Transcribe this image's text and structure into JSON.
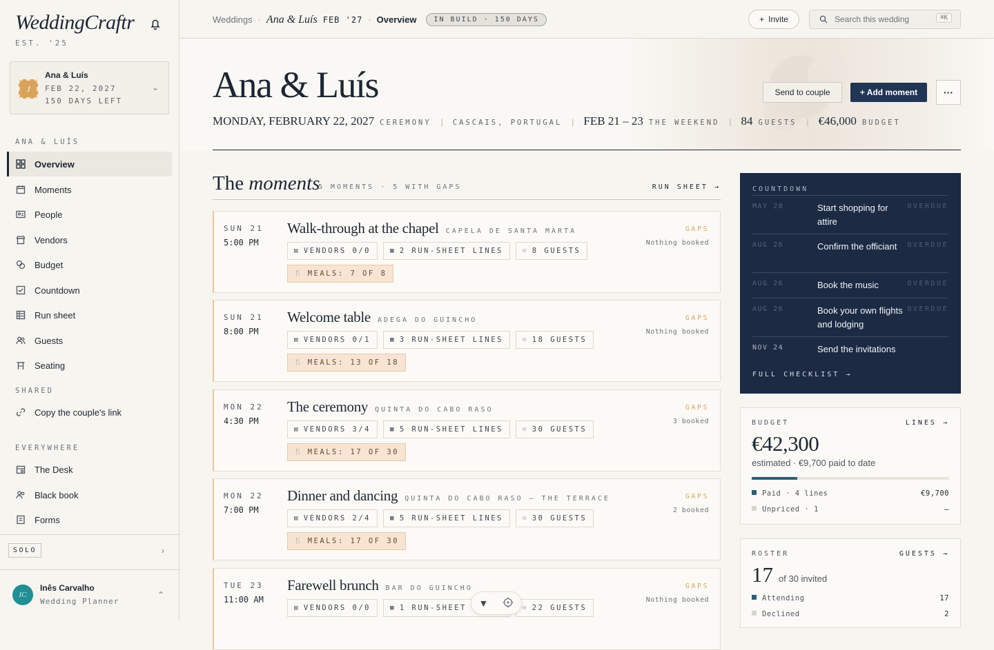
{
  "app": {
    "logo": "WeddingCraftr",
    "est": "EST. '25"
  },
  "wedding_card": {
    "stamp": "J",
    "names": "Ana & Luís",
    "date": "FEB 22, 2027",
    "left": "150 DAYS LEFT"
  },
  "sidebar": {
    "section_couple": "ANA & LUÍS",
    "items": [
      {
        "label": "Overview",
        "icon": "grid-icon"
      },
      {
        "label": "Moments",
        "icon": "calendar-icon"
      },
      {
        "label": "People",
        "icon": "id-card-icon"
      },
      {
        "label": "Vendors",
        "icon": "store-icon"
      },
      {
        "label": "Budget",
        "icon": "coins-icon"
      },
      {
        "label": "Countdown",
        "icon": "checklist-icon"
      },
      {
        "label": "Run sheet",
        "icon": "run-sheet-icon"
      },
      {
        "label": "Guests",
        "icon": "users-icon"
      },
      {
        "label": "Seating",
        "icon": "table-icon"
      }
    ],
    "section_shared": "SHARED",
    "shared_items": [
      {
        "label": "Copy the couple's link",
        "icon": "link-icon"
      }
    ],
    "section_everywhere": "EVERYWHERE",
    "everywhere_items": [
      {
        "label": "The Desk",
        "icon": "desk-icon"
      },
      {
        "label": "Black book",
        "icon": "contacts-icon"
      },
      {
        "label": "Forms",
        "icon": "form-icon"
      }
    ],
    "mode": "SOLO",
    "user": {
      "initials": "IC",
      "name": "Inês Carvalho",
      "role": "Wedding Planner"
    }
  },
  "topbar": {
    "crumb_root": "Weddings",
    "crumb_couple": "Ana & Luís",
    "crumb_date": "FEB '27",
    "crumb_current": "Overview",
    "status_badge": "IN BUILD · 150 DAYS",
    "invite_label": "Invite",
    "search_placeholder": "Search this wedding",
    "search_shortcut": "⌘K"
  },
  "hero": {
    "title": "Ana & Luís",
    "date": "MONDAY, FEBRUARY 22, 2027",
    "date_label": "CEREMONY",
    "location": "CASCAIS, PORTUGAL",
    "weekend": "FEB 21 – 23",
    "weekend_label": "THE WEEKEND",
    "guests": "84",
    "guests_label": "GUESTS",
    "budget": "€46,000",
    "budget_label": "BUDGET",
    "send_label": "Send to couple",
    "add_label": "+ Add moment",
    "more_label": "···"
  },
  "moments": {
    "title_plain": "The",
    "title_italic": "moments",
    "summary": "5 MOMENTS · 5 WITH GAPS",
    "run_sheet_link": "RUN SHEET →",
    "items": [
      {
        "day": "SUN 21",
        "time": "5:00 PM",
        "name": "Walk-through at the chapel",
        "venue": "CAPELA DE SANTA MARTA",
        "status": "GAPS",
        "booked": "Nothing booked",
        "vendors": "VENDORS 0/0",
        "lines": "2 RUN-SHEET LINES",
        "guests": "8 GUESTS",
        "meals": "MEALS: 7 OF 8"
      },
      {
        "day": "SUN 21",
        "time": "8:00 PM",
        "name": "Welcome table",
        "venue": "ADEGA DO GUINCHO",
        "status": "GAPS",
        "booked": "Nothing booked",
        "vendors": "VENDORS 0/1",
        "lines": "3 RUN-SHEET LINES",
        "guests": "18 GUESTS",
        "meals": "MEALS: 13 OF 18"
      },
      {
        "day": "MON 22",
        "time": "4:30 PM",
        "name": "The ceremony",
        "venue": "QUINTA DO CABO RASO",
        "status": "GAPS",
        "booked": "3 booked",
        "vendors": "VENDORS 3/4",
        "lines": "5 RUN-SHEET LINES",
        "guests": "30 GUESTS",
        "meals": "MEALS: 17 OF 30"
      },
      {
        "day": "MON 22",
        "time": "7:00 PM",
        "name": "Dinner and dancing",
        "venue": "QUINTA DO CABO RASO — THE TERRACE",
        "status": "GAPS",
        "booked": "2 booked",
        "vendors": "VENDORS 2/4",
        "lines": "5 RUN-SHEET LINES",
        "guests": "30 GUESTS",
        "meals": "MEALS: 17 OF 30"
      },
      {
        "day": "TUE 23",
        "time": "11:00 AM",
        "name": "Farewell brunch",
        "venue": "BAR DO GUINCHO",
        "status": "GAPS",
        "booked": "Nothing booked",
        "vendors": "VENDORS 0/0",
        "lines": "1 RUN-SHEET LINES",
        "guests": "22 GUESTS",
        "meals": ""
      }
    ]
  },
  "countdown": {
    "label": "COUNTDOWN",
    "items": [
      {
        "date": "MAY 28",
        "task": "Start shopping for attire",
        "status": "OVERDUE"
      },
      {
        "date": "AUG 26",
        "task": "Confirm the officiant",
        "status": "OVERDUE"
      },
      {
        "date": "AUG 26",
        "task": "Book the music",
        "status": "OVERDUE"
      },
      {
        "date": "AUG 26",
        "task": "Book your own flights and lodging",
        "status": "OVERDUE"
      },
      {
        "date": "NOV 24",
        "task": "Send the invitations",
        "status": ""
      }
    ],
    "footer": "FULL CHECKLIST →"
  },
  "budget": {
    "label": "BUDGET",
    "link": "LINES →",
    "amount": "€42,300",
    "sub": "estimated · €9,700 paid to date",
    "paid_fraction": 0.23,
    "rows": [
      {
        "label": "Paid · 4 lines",
        "value": "€9,700",
        "color": "#2b5e7a"
      },
      {
        "label": "Unpriced · 1",
        "value": "—",
        "color": "#d8d5ce"
      }
    ]
  },
  "roster": {
    "label": "ROSTER",
    "link": "GUESTS →",
    "count": "17",
    "of": "of 30 invited",
    "rows": [
      {
        "label": "Attending",
        "value": "17",
        "color": "#2b5e7a"
      },
      {
        "label": "Declined",
        "value": "2",
        "color": "#d8d5ce"
      }
    ]
  },
  "float": {
    "logo_icon": "v-logo-icon",
    "target_icon": "crosshair-icon"
  }
}
